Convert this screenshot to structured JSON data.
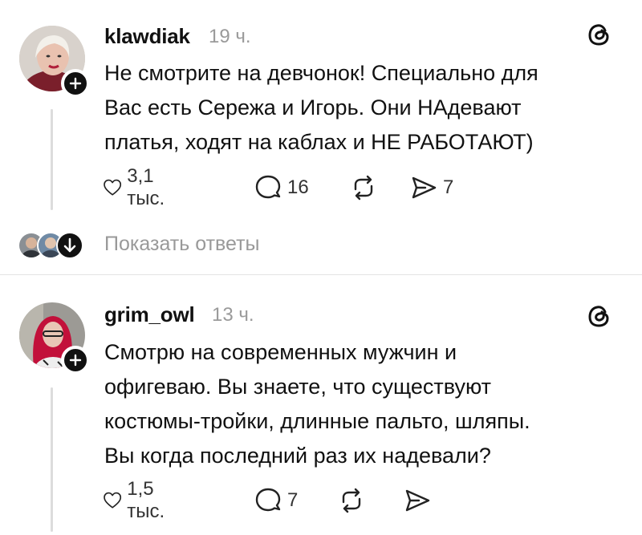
{
  "posts": [
    {
      "username": "klawdiak",
      "time": "19 ч.",
      "lines": [
        "Не смотрите на девчонок! Специально для",
        "Вас есть Сережа и Игорь. Они НАдевают",
        "платья, ходят на каблах и НЕ РАБОТАЮТ)"
      ],
      "likes": "3,1 тыс.",
      "replies": "16",
      "shares": "7",
      "show_replies_label": "Показать ответы"
    },
    {
      "username": "grim_owl",
      "time": "13 ч.",
      "lines": [
        "Смотрю на современных мужчин и",
        "офигеваю. Вы знаете, что существуют",
        "костюмы-тройки, длинные пальто, шляпы.",
        "Вы когда последний раз их надевали?"
      ],
      "likes": "1,5 тыс.",
      "replies": "7"
    }
  ],
  "icons": {
    "like": "heart-icon",
    "reply": "comment-icon",
    "repost": "repost-icon",
    "share": "send-icon",
    "app": "threads-logo-icon",
    "follow": "plus-icon",
    "expand": "arrow-down-icon"
  },
  "colors": {
    "text": "#111111",
    "muted": "#9a9a9a",
    "divider": "#e3e3e3",
    "thread_line": "#dcdcdc"
  }
}
